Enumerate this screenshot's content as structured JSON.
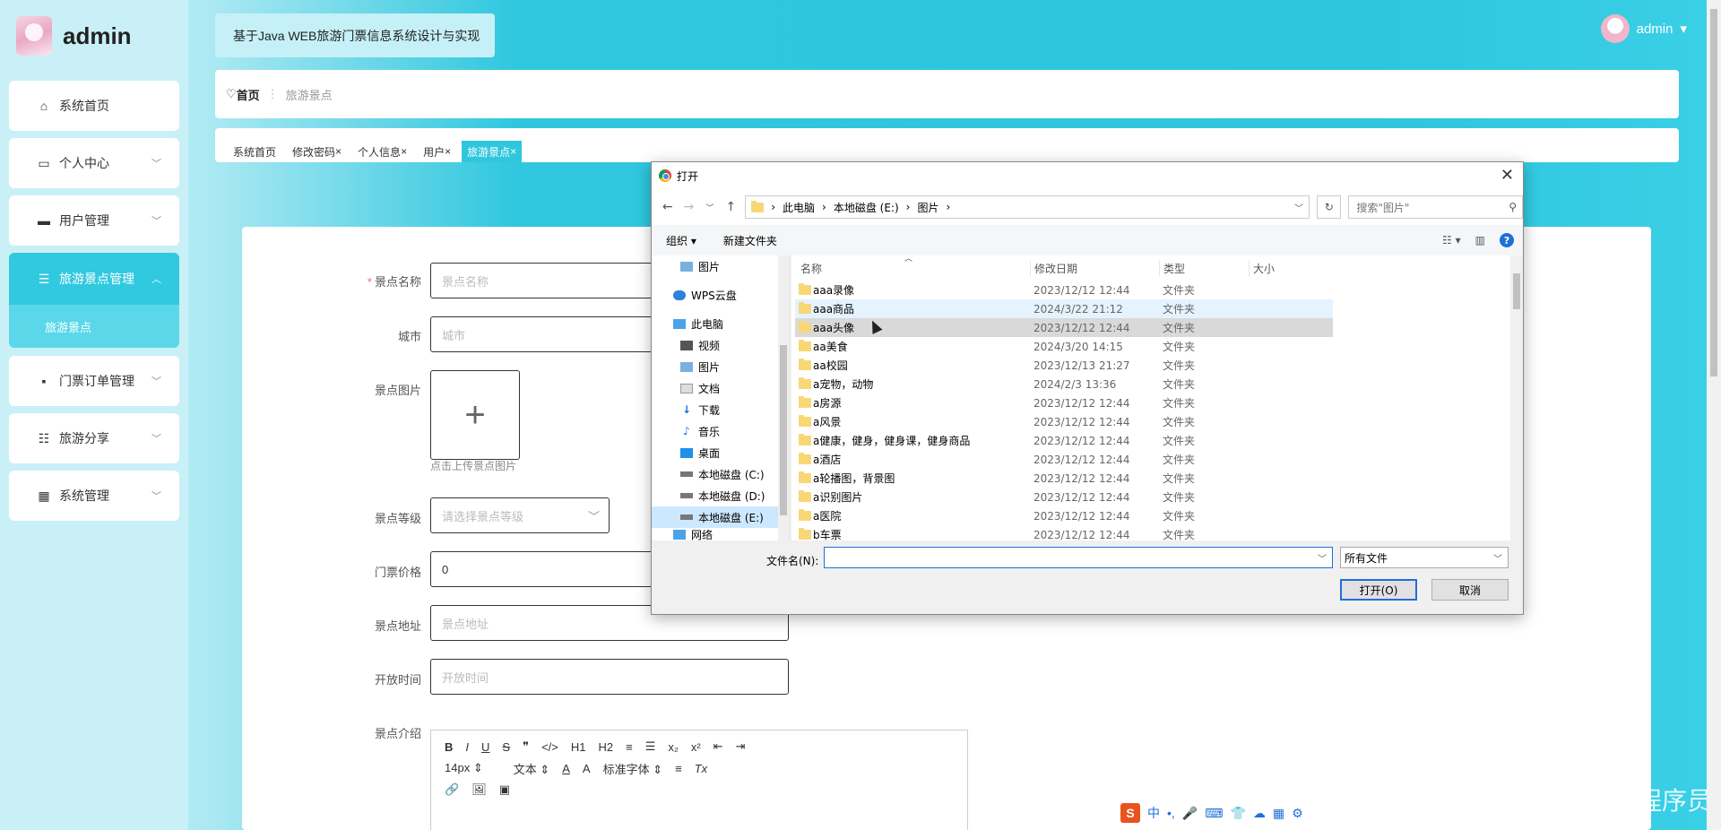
{
  "brand": {
    "name": "admin"
  },
  "system_title": "基于Java WEB旅游门票信息系统设计与实现",
  "user": {
    "name": "admin",
    "caret": "▾"
  },
  "sidebar": {
    "items": [
      {
        "label": "系统首页",
        "icon": "home-icon"
      },
      {
        "label": "个人中心",
        "icon": "id-card-icon"
      },
      {
        "label": "用户管理",
        "icon": "briefcase-icon"
      },
      {
        "label": "旅游景点管理",
        "icon": "list-icon"
      },
      {
        "label": "门票订单管理",
        "icon": "message-icon"
      },
      {
        "label": "旅游分享",
        "icon": "sliders-icon"
      },
      {
        "label": "系统管理",
        "icon": "grid-icon"
      }
    ],
    "sub_item": "旅游景点"
  },
  "breadcrumb": {
    "home": "首页",
    "current": "旅游景点"
  },
  "tags": [
    "系统首页",
    "修改密码",
    "个人信息",
    "用户",
    "旅游景点"
  ],
  "form": {
    "name_label": "景点名称",
    "name_placeholder": "景点名称",
    "city_label": "城市",
    "city_placeholder": "城市",
    "image_label": "景点图片",
    "upload_tip": "点击上传景点图片",
    "level_label": "景点等级",
    "level_placeholder": "请选择景点等级",
    "price_label": "门票价格",
    "price_value": "0",
    "address_label": "景点地址",
    "address_placeholder": "景点地址",
    "open_label": "开放时间",
    "open_placeholder": "开放时间",
    "intro_label": "景点介绍"
  },
  "editor": {
    "row1": [
      "B",
      "I",
      "U",
      "S",
      "❞",
      "</>",
      "H1",
      "H2",
      "≡",
      "☰",
      "x₂",
      "x²",
      "⇤",
      "⇥"
    ],
    "font_size": "14px",
    "text_style": "文本",
    "font_family": "标准字体",
    "row2_extra": [
      "A",
      "A",
      "≡",
      "Tx"
    ],
    "row3": [
      "🔗",
      "🖼",
      "▣"
    ]
  },
  "dialog": {
    "title": "打开",
    "path": [
      "此电脑",
      "本地磁盘 (E:)",
      "图片"
    ],
    "search_placeholder": "搜索\"图片\"",
    "organize": "组织 ▾",
    "new_folder": "新建文件夹",
    "tree": [
      {
        "label": "图片",
        "icon": "pictures-icon"
      },
      {
        "label": "WPS云盘",
        "icon": "cloud-icon"
      },
      {
        "label": "此电脑",
        "icon": "computer-icon"
      },
      {
        "label": "视频",
        "icon": "video-icon"
      },
      {
        "label": "图片",
        "icon": "pictures-icon"
      },
      {
        "label": "文档",
        "icon": "document-icon"
      },
      {
        "label": "下载",
        "icon": "download-icon"
      },
      {
        "label": "音乐",
        "icon": "music-icon"
      },
      {
        "label": "桌面",
        "icon": "desktop-icon"
      },
      {
        "label": "本地磁盘 (C:)",
        "icon": "drive-icon"
      },
      {
        "label": "本地磁盘 (D:)",
        "icon": "drive-icon"
      },
      {
        "label": "本地磁盘 (E:)",
        "icon": "drive-icon"
      },
      {
        "label": "网络",
        "icon": "network-icon"
      }
    ],
    "columns": [
      "名称",
      "修改日期",
      "类型",
      "大小"
    ],
    "files": [
      {
        "name": "aaa录像",
        "date": "2023/12/12 12:44",
        "type": "文件夹"
      },
      {
        "name": "aaa商品",
        "date": "2024/3/22 21:12",
        "type": "文件夹"
      },
      {
        "name": "aaa头像",
        "date": "2023/12/12 12:44",
        "type": "文件夹"
      },
      {
        "name": "aa美食",
        "date": "2024/3/20 14:15",
        "type": "文件夹"
      },
      {
        "name": "aa校园",
        "date": "2023/12/13 21:27",
        "type": "文件夹"
      },
      {
        "name": "a宠物，动物",
        "date": "2024/2/3 13:36",
        "type": "文件夹"
      },
      {
        "name": "a房源",
        "date": "2023/12/12 12:44",
        "type": "文件夹"
      },
      {
        "name": "a风景",
        "date": "2023/12/12 12:44",
        "type": "文件夹"
      },
      {
        "name": "a健康，健身，健身课，健身商品",
        "date": "2023/12/12 12:44",
        "type": "文件夹"
      },
      {
        "name": "a酒店",
        "date": "2023/12/12 12:44",
        "type": "文件夹"
      },
      {
        "name": "a轮播图，背景图",
        "date": "2023/12/12 12:44",
        "type": "文件夹"
      },
      {
        "name": "a识别图片",
        "date": "2023/12/12 12:44",
        "type": "文件夹"
      },
      {
        "name": "a医院",
        "date": "2023/12/12 12:44",
        "type": "文件夹"
      },
      {
        "name": "b车票",
        "date": "2023/12/12 12:44",
        "type": "文件夹"
      }
    ],
    "filename_label": "文件名(N):",
    "filename_value": "",
    "filetype": "所有文件",
    "open_button": "打开(O)",
    "cancel_button": "取消"
  },
  "ime": {
    "items": [
      "中",
      "•,",
      "🎤",
      "⌨",
      "👕",
      "☁",
      "▦",
      "⚙"
    ]
  },
  "watermark": "CSDN @毕业程序员"
}
